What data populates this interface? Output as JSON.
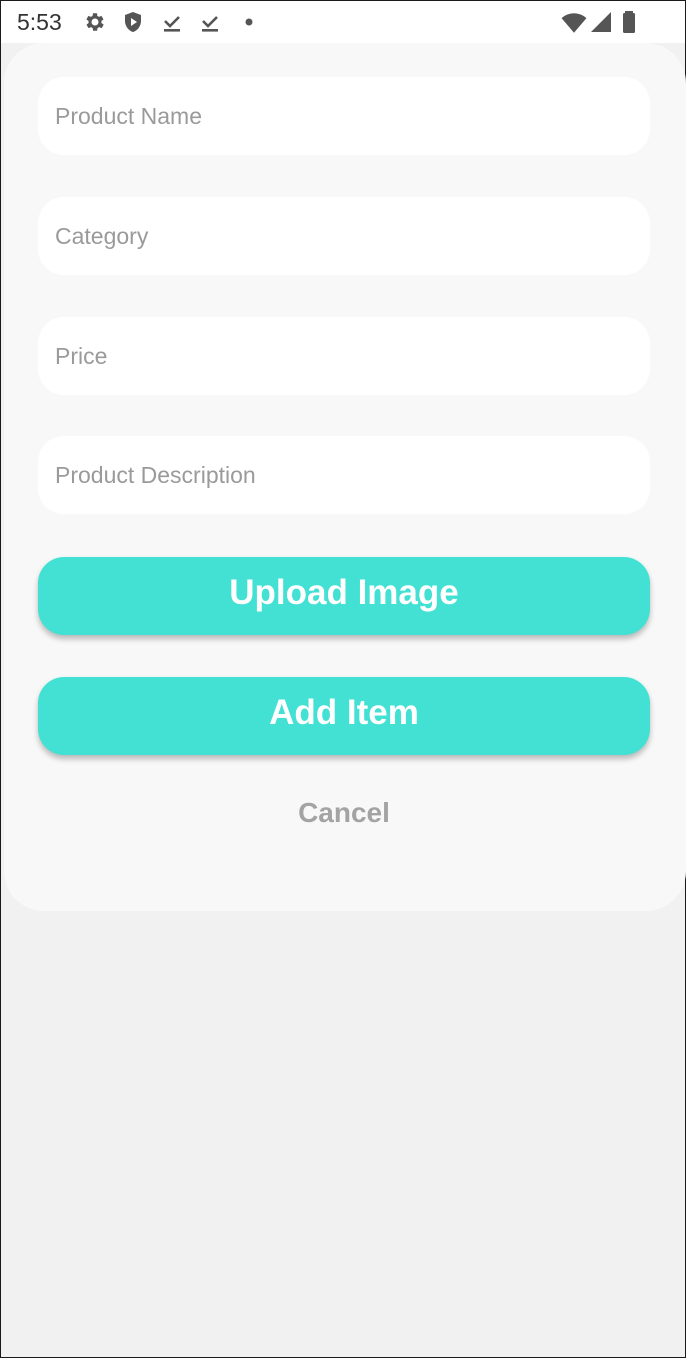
{
  "status_bar": {
    "time": "5:53",
    "left_icons": [
      "gear-icon",
      "shield-icon",
      "download-done-icon",
      "download-done-icon",
      "dot-icon"
    ],
    "right_icons": [
      "wifi-icon",
      "cell-signal-icon",
      "battery-icon"
    ]
  },
  "form": {
    "product_name_placeholder": "Product Name",
    "category_placeholder": "Category",
    "price_placeholder": "Price",
    "description_placeholder": "Product Description",
    "upload_label": "Upload Image",
    "add_label": "Add Item",
    "cancel_label": "Cancel"
  },
  "colors": {
    "accent": "#43e1d3",
    "card_bg": "#f8f8f8",
    "page_bg": "#f2f1f2",
    "placeholder": "#9a9a9a",
    "cancel_text": "#a3a3a3"
  }
}
